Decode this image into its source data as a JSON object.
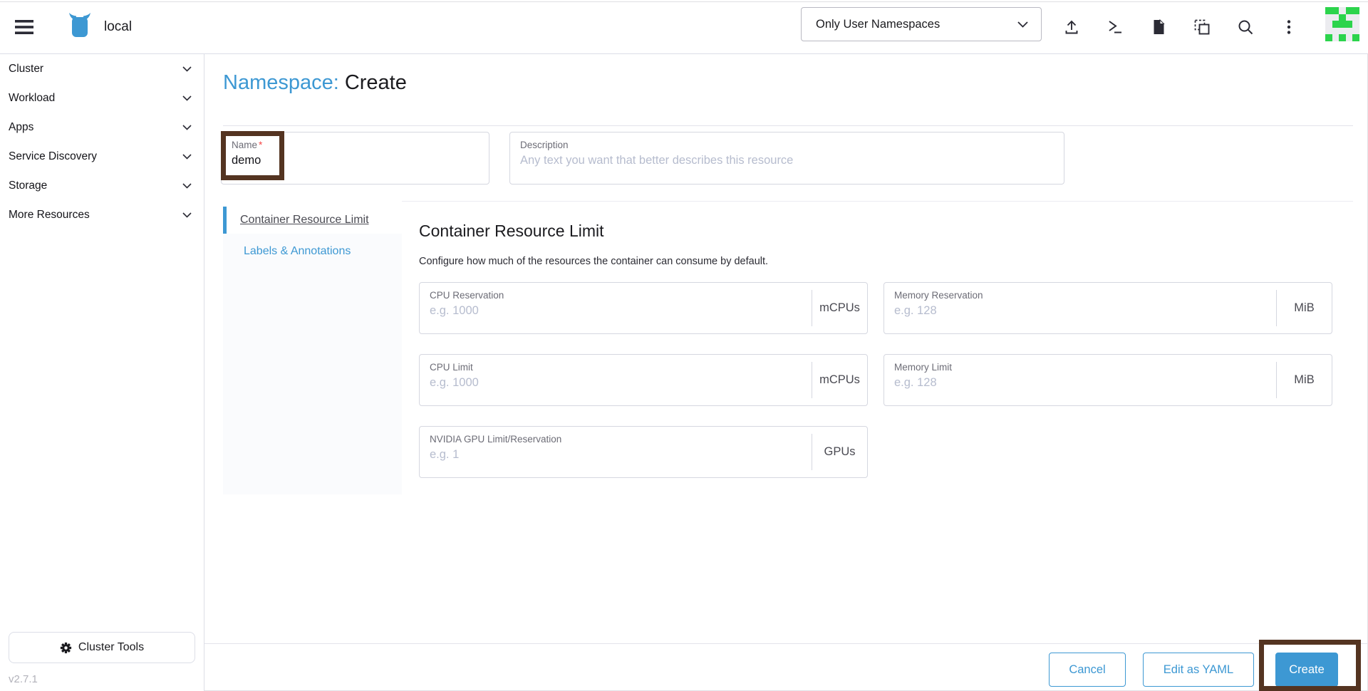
{
  "header": {
    "cluster_name": "local",
    "namespace_filter": "Only User Namespaces",
    "icons": [
      "hamburger-menu-icon",
      "rancher-logo",
      "chevron-down-icon",
      "upload-icon",
      "kubectl-shell-icon",
      "docs-icon",
      "resource-copy-icon",
      "search-icon",
      "kebab-menu-icon",
      "user-avatar"
    ],
    "avatar": {
      "green": "#2cd44c",
      "bg": "#ececf0",
      "pattern": [
        [
          1,
          1,
          0,
          1,
          1
        ],
        [
          0,
          0,
          1,
          0,
          0
        ],
        [
          0,
          1,
          1,
          1,
          0
        ],
        [
          0,
          0,
          0,
          0,
          0
        ],
        [
          1,
          0,
          1,
          0,
          1
        ]
      ]
    }
  },
  "sidebar": {
    "items": [
      "Cluster",
      "Workload",
      "Apps",
      "Service Discovery",
      "Storage",
      "More Resources"
    ],
    "cluster_tools_label": "Cluster Tools",
    "version": "v2.7.1"
  },
  "page": {
    "title_resource": "Namespace:",
    "title_action": "Create"
  },
  "form": {
    "name": {
      "label": "Name",
      "required_mark": "*",
      "value": "demo"
    },
    "description": {
      "label": "Description",
      "placeholder": "Any text you want that better describes this resource"
    }
  },
  "tabs": [
    {
      "label": "Container Resource Limit",
      "active": true
    },
    {
      "label": "Labels & Annotations",
      "active": false
    }
  ],
  "section": {
    "title": "Container Resource Limit",
    "subtitle": "Configure how much of the resources the container can consume by default.",
    "fields": [
      {
        "label": "CPU Reservation",
        "placeholder": "e.g. 1000",
        "unit": "mCPUs"
      },
      {
        "label": "Memory Reservation",
        "placeholder": "e.g. 128",
        "unit": "MiB"
      },
      {
        "label": "CPU Limit",
        "placeholder": "e.g. 1000",
        "unit": "mCPUs"
      },
      {
        "label": "Memory Limit",
        "placeholder": "e.g. 128",
        "unit": "MiB"
      },
      {
        "label": "NVIDIA GPU Limit/Reservation",
        "placeholder": "e.g. 1",
        "unit": "GPUs"
      }
    ]
  },
  "footer": {
    "cancel_label": "Cancel",
    "edit_yaml_label": "Edit as YAML",
    "create_label": "Create"
  },
  "annotations": {
    "highlight_color": "#543421",
    "regions": [
      "name-field",
      "create-button"
    ]
  },
  "colors": {
    "primary": "#3d98d3",
    "text": "#141419",
    "label_muted": "#6c6c76",
    "placeholder": "#b6bcce",
    "border": "#dcdee7"
  }
}
